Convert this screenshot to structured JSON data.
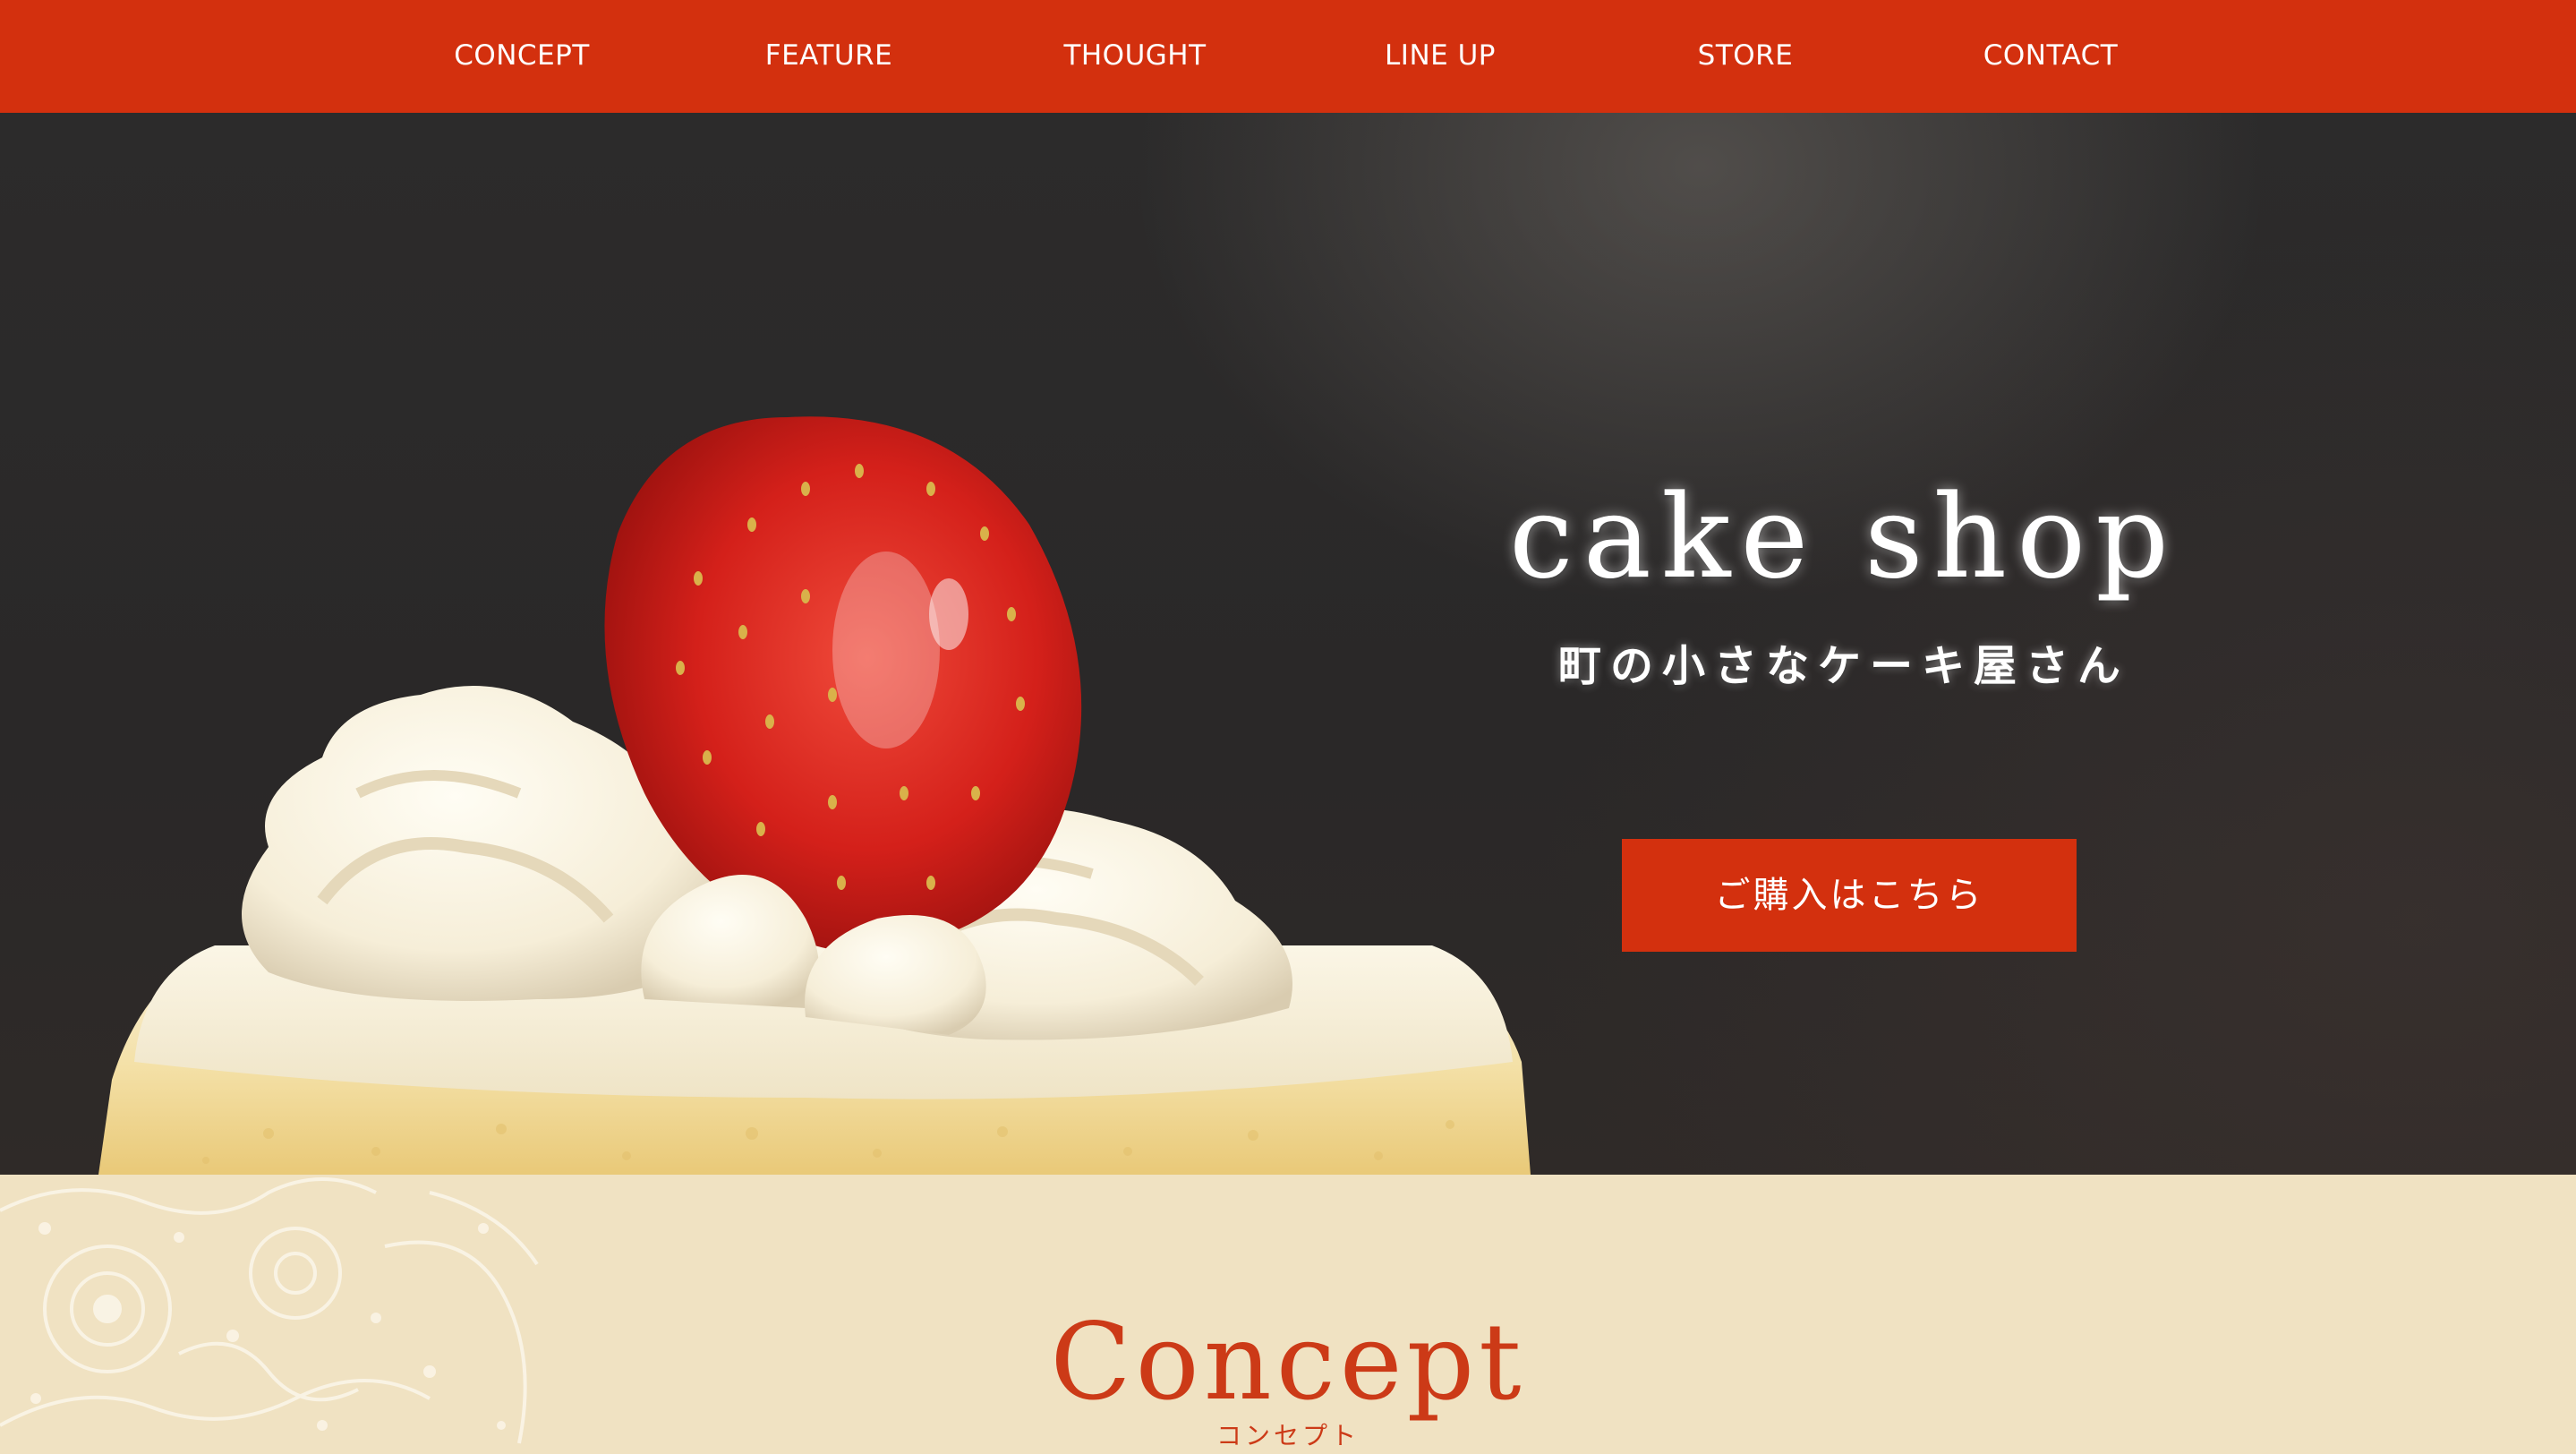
{
  "nav": {
    "items": [
      {
        "label": "CONCEPT"
      },
      {
        "label": "FEATURE"
      },
      {
        "label": "THOUGHT"
      },
      {
        "label": "LINE UP"
      },
      {
        "label": "STORE"
      },
      {
        "label": "CONTACT"
      }
    ]
  },
  "hero": {
    "title": "cake shop",
    "subtitle": "町の小さなケーキ屋さん",
    "button_label": "ご購入はこちら"
  },
  "concept": {
    "title": "Concept",
    "subtitle": "コンセプト"
  },
  "colors": {
    "brand_red": "#d3300e",
    "cream": "#f0e2c2",
    "hero_dark": "#2c2b2b",
    "concept_text": "#cc3a17"
  },
  "icons": [
    "strawberry-shortcake-photo",
    "lace-doily-ornament"
  ]
}
